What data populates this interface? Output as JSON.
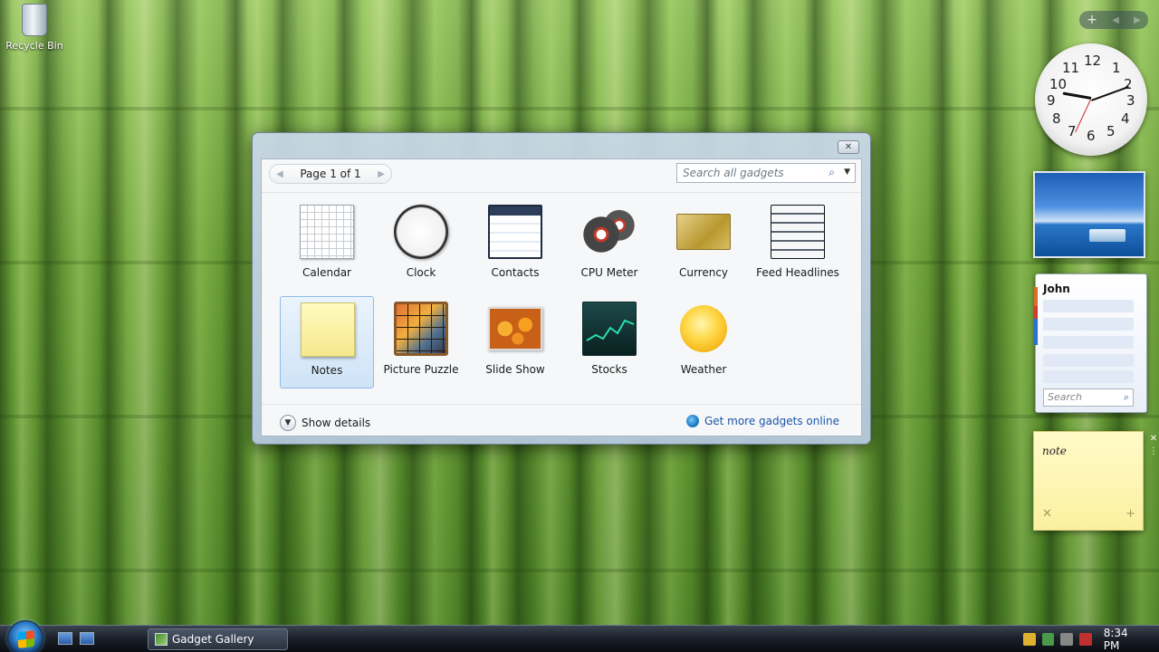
{
  "desktop": {
    "recycle_bin_label": "Recycle Bin"
  },
  "sidebar": {
    "clock_numbers": [
      "12",
      "1",
      "2",
      "3",
      "4",
      "5",
      "6",
      "7",
      "8",
      "9",
      "10",
      "11"
    ],
    "contacts": {
      "name": "John",
      "search_placeholder": "Search"
    },
    "notes": {
      "text": "note"
    }
  },
  "gallery": {
    "pager_label": "Page 1 of 1",
    "search_placeholder": "Search all gadgets",
    "items": [
      {
        "label": "Calendar",
        "icon": "calendar-icon"
      },
      {
        "label": "Clock",
        "icon": "clock-icon"
      },
      {
        "label": "Contacts",
        "icon": "contacts-icon"
      },
      {
        "label": "CPU Meter",
        "icon": "cpu-meter-icon"
      },
      {
        "label": "Currency",
        "icon": "currency-icon"
      },
      {
        "label": "Feed Headlines",
        "icon": "feed-headlines-icon"
      },
      {
        "label": "Notes",
        "icon": "notes-icon",
        "selected": true
      },
      {
        "label": "Picture Puzzle",
        "icon": "picture-puzzle-icon"
      },
      {
        "label": "Slide Show",
        "icon": "slide-show-icon"
      },
      {
        "label": "Stocks",
        "icon": "stocks-icon"
      },
      {
        "label": "Weather",
        "icon": "weather-icon"
      }
    ],
    "show_details_label": "Show details",
    "get_more_label": "Get more gadgets online"
  },
  "taskbar": {
    "task_button_label": "Gadget Gallery",
    "clock": "8:34 PM"
  },
  "colors": {
    "selection": "#cfe3f7",
    "link": "#1b56a6"
  }
}
